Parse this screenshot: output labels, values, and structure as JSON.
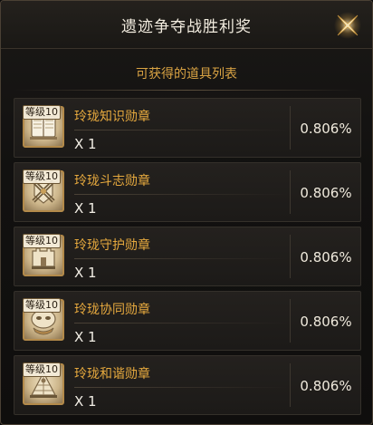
{
  "dialog": {
    "title": "遗迹争夺战胜利奖",
    "subtitle": "可获得的道具列表"
  },
  "items": [
    {
      "level": "等级10",
      "name": "玲珑知识勋章",
      "qty": "X 1",
      "chance": "0.806%",
      "icon": "book-medal-icon"
    },
    {
      "level": "等级10",
      "name": "玲珑斗志勋章",
      "qty": "X 1",
      "chance": "0.806%",
      "icon": "swords-shield-medal-icon"
    },
    {
      "level": "等级10",
      "name": "玲珑守护勋章",
      "qty": "X 1",
      "chance": "0.806%",
      "icon": "fortress-medal-icon"
    },
    {
      "level": "等级10",
      "name": "玲珑协同勋章",
      "qty": "X 1",
      "chance": "0.806%",
      "icon": "mask-medal-icon"
    },
    {
      "level": "等级10",
      "name": "玲珑和谐勋章",
      "qty": "X 1",
      "chance": "0.806%",
      "icon": "pyramid-medal-icon"
    }
  ],
  "colors": {
    "title": "#f2ecdf",
    "accent": "#e6a93e",
    "value": "#efe9dc"
  }
}
